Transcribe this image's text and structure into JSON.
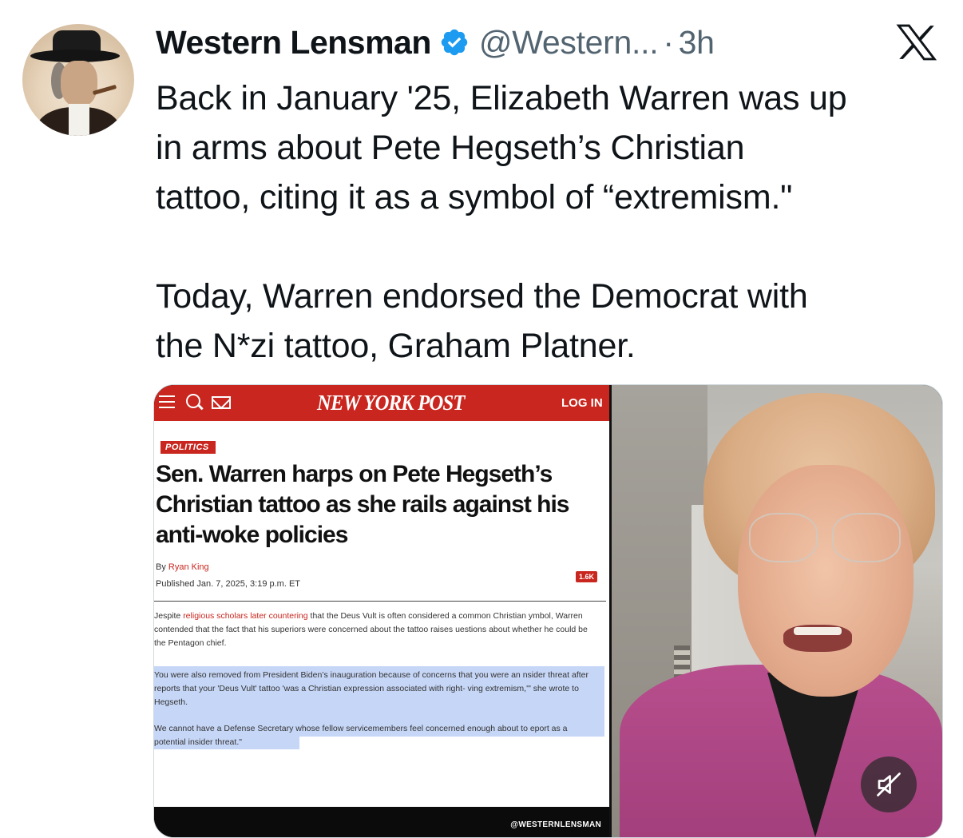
{
  "tweet": {
    "author_name": "Western Lensman",
    "handle": "@Western...",
    "separator": "·",
    "time": "3h",
    "text": "Back in January '25, Elizabeth Warren was up\nin arms about Pete Hegseth’s Christian\ntattoo, citing it as a symbol of “extremism.\"\n\nToday, Warren endorsed the Democrat with\nthe N*zi tattoo, Graham Platner."
  },
  "icons": {
    "verified": "verified-badge-icon",
    "platform": "x-logo-icon",
    "mute": "muted-speaker-icon"
  },
  "colors": {
    "verified_blue": "#1d9bf0",
    "nyp_red": "#c8261e",
    "handle_gray": "#536471",
    "highlight_blue": "#c6d6f6"
  },
  "media": {
    "nyp": {
      "logo": "NEW YORK POST",
      "login": "LOG IN",
      "section_tag": "POLITICS",
      "headline": "Sen. Warren harps on Pete Hegseth’s Christian tattoo as she rails against his anti-woke policies",
      "byline_prefix": "By ",
      "author": "Ryan King",
      "published": "Published Jan. 7, 2025, 3:19 p.m. ET",
      "comment_count": "1.6K",
      "para1_start": "Jespite ",
      "para1_link": "religious scholars later countering",
      "para1_rest": " that the Deus Vult is often considered a common Christian ymbol, Warren contended that the fact that his superiors were concerned about the tattoo raises uestions about whether he could be the Pentagon chief.",
      "para2": "You were also removed from President Biden’s inauguration because of concerns that you were an nsider threat after reports that your 'Deus Vult' tattoo 'was a Christian expression associated with right- ving extremism,'\" she wrote to Hegseth.",
      "para3": "We cannot have a Defense Secretary whose fellow servicemembers feel concerned enough about to eport as a potential insider threat.\""
    },
    "watermark": "@WESTERNLENSMAN"
  }
}
